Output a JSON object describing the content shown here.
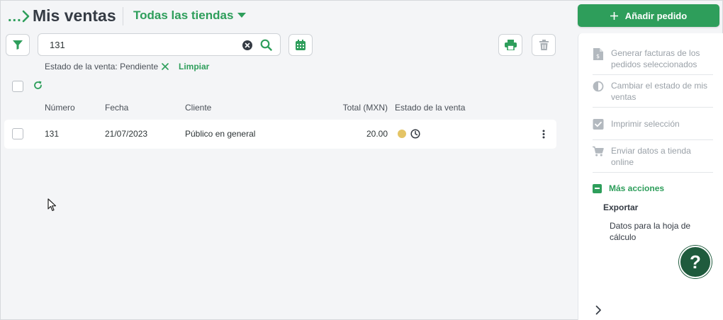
{
  "header": {
    "breadcrumb_dots": "...",
    "title": "Mis ventas",
    "store_selector": "Todas las tiendas",
    "add_order_label": "Añadir pedido"
  },
  "search": {
    "value": "131",
    "placeholder": ""
  },
  "filter": {
    "label": "Estado de la venta: Pendiente",
    "clear_label": "Limpiar"
  },
  "table": {
    "columns": [
      "Número",
      "Fecha",
      "Cliente",
      "Total (MXN)",
      "Estado de la venta"
    ],
    "rows": [
      {
        "number": "131",
        "date": "21/07/2023",
        "client": "Público en general",
        "total": "20.00",
        "status_color": "#e4c465"
      }
    ]
  },
  "panel": {
    "items": [
      {
        "label": "Generar facturas de los pedidos seleccionados",
        "icon": "invoice-icon"
      },
      {
        "label": "Cambiar el estado de mis ventas",
        "icon": "half-circle-icon"
      },
      {
        "label": "Imprimir selección",
        "icon": "checkbox-icon"
      },
      {
        "label": "Enviar datos a tienda online",
        "icon": "cart-icon"
      }
    ],
    "more_actions": "Más acciones",
    "export_label": "Exportar",
    "export_item": "Datos para la hoja de cálculo"
  },
  "help": {
    "label": "?"
  },
  "colors": {
    "accent": "#2e9e5b",
    "help_bg": "#1f5b3d",
    "pending": "#e4c465"
  }
}
